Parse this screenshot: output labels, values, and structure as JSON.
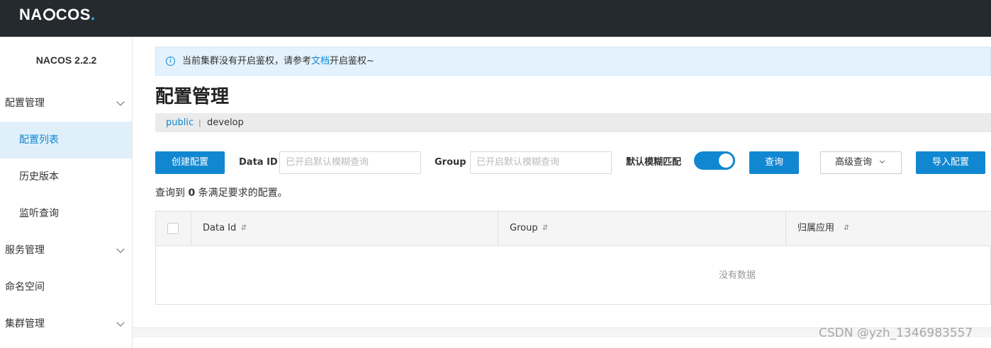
{
  "header": {
    "logo_text": "NACOS"
  },
  "sidebar": {
    "version": "NACOS 2.2.2",
    "items": [
      {
        "label": "配置管理",
        "expanded": true
      },
      {
        "label": "配置列表",
        "active": true
      },
      {
        "label": "历史版本"
      },
      {
        "label": "监听查询"
      },
      {
        "label": "服务管理"
      },
      {
        "label": "命名空间"
      },
      {
        "label": "集群管理"
      }
    ]
  },
  "notice": {
    "icon": "info-icon",
    "text_before": "当前集群没有开启鉴权，请参考",
    "link": "文档",
    "text_after": "开启鉴权~"
  },
  "page": {
    "title": "配置管理"
  },
  "namespaces": {
    "public": "public",
    "separator": "|",
    "develop": "develop"
  },
  "toolbar": {
    "create_button": "创建配置",
    "data_id_label": "Data ID",
    "data_id_placeholder": "已开启默认模糊查询",
    "group_label": "Group",
    "group_placeholder": "已开启默认模糊查询",
    "fuzzy_label": "默认模糊匹配",
    "fuzzy_enabled": true,
    "search_button": "查询",
    "advanced_button": "高级查询",
    "import_button": "导入配置"
  },
  "result": {
    "prefix": "查询到",
    "count": "0",
    "suffix": "条满足要求的配置。"
  },
  "table": {
    "columns": [
      "Data Id",
      "Group",
      "归属应用"
    ],
    "sort_icon": "⇵",
    "empty_text": "没有数据"
  },
  "watermark": "CSDN @yzh_1346983557",
  "colors": {
    "accent": "#1187d1",
    "topbar": "#252a2f",
    "active_bg": "#e0f0fb"
  }
}
